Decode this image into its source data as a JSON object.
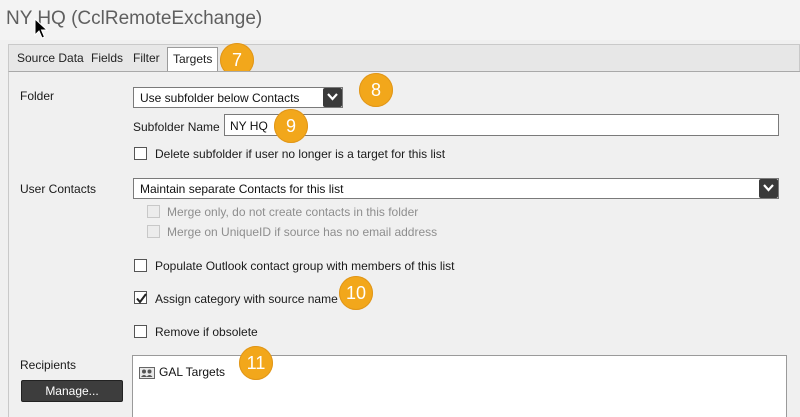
{
  "window": {
    "title": "NY HQ (CclRemoteExchange)"
  },
  "tabs": [
    {
      "label": "Source Data"
    },
    {
      "label": "Fields"
    },
    {
      "label": "Filter"
    },
    {
      "label": "Targets"
    }
  ],
  "active_tab": "Targets",
  "folder": {
    "label": "Folder",
    "selected": "Use subfolder below Contacts",
    "subfolder_label": "Subfolder Name",
    "subfolder_value": "NY HQ",
    "delete_subfolder_label": "Delete subfolder if user no longer is a target for this list",
    "delete_subfolder_checked": false
  },
  "user_contacts": {
    "label": "User Contacts",
    "selected": "Maintain separate Contacts for this list",
    "merge_only_label": "Merge only, do not create contacts in this folder",
    "merge_uniqueid_label": "Merge on UniqueID if source has no email address",
    "populate_group_label": "Populate Outlook contact group with members of this list",
    "populate_group_checked": false,
    "assign_category_label": "Assign category with source name",
    "assign_category_checked": true,
    "remove_obsolete_label": "Remove if obsolete",
    "remove_obsolete_checked": false
  },
  "recipients": {
    "label": "Recipients",
    "manage_button": "Manage...",
    "items": [
      {
        "name": "GAL Targets",
        "icon": "group-icon"
      }
    ]
  },
  "callouts": {
    "c7": "7",
    "c8": "8",
    "c9": "9",
    "c10": "10",
    "c11": "11"
  },
  "colors": {
    "callout": "#f2a71b",
    "button_dark": "#3d3d3d"
  }
}
